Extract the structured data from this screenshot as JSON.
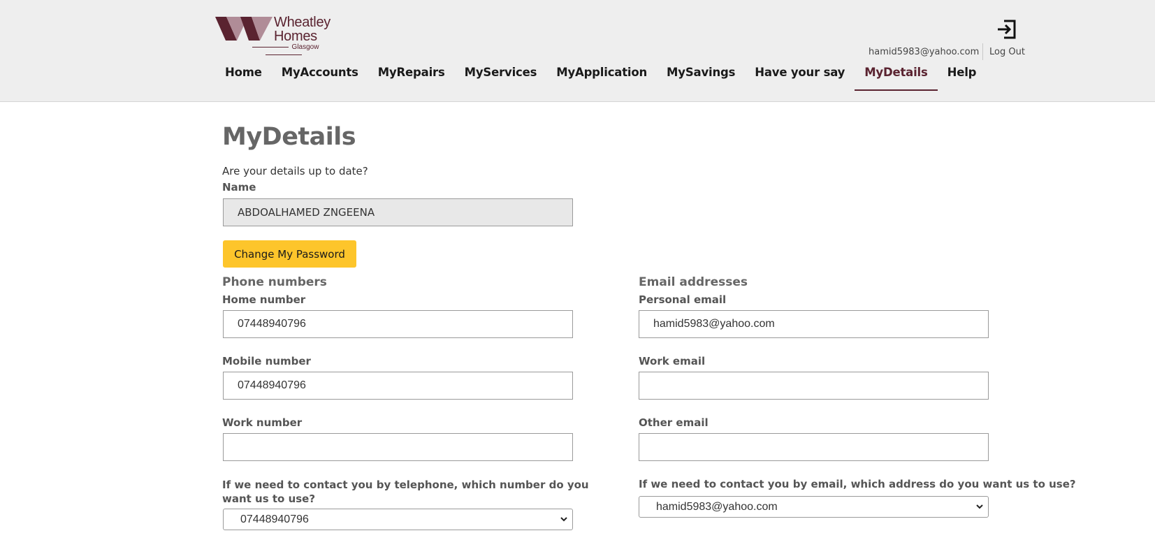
{
  "brand": {
    "line1": "Wheatley",
    "line2": "Homes",
    "sub": "Glasgow"
  },
  "header": {
    "user_email": "hamid5983@yahoo.com",
    "logout_label": "Log Out"
  },
  "nav": {
    "items": [
      {
        "label": "Home"
      },
      {
        "label": "MyAccounts"
      },
      {
        "label": "MyRepairs"
      },
      {
        "label": "MyServices"
      },
      {
        "label": "MyApplication"
      },
      {
        "label": "MySavings"
      },
      {
        "label": "Have your say"
      },
      {
        "label": "MyDetails",
        "active": true
      },
      {
        "label": "Help"
      }
    ]
  },
  "main": {
    "title": "MyDetails",
    "intro": "Are your details up to date?",
    "name_label": "Name",
    "name_value": "ABDOALHAMED ZNGEENA",
    "change_password_label": "Change My Password",
    "phone": {
      "section_title": "Phone numbers",
      "home_label": "Home number",
      "home_value": "07448940796",
      "mobile_label": "Mobile number",
      "mobile_value": "07448940796",
      "work_label": "Work number",
      "work_value": "",
      "preferred_label": "If we need to contact you by telephone, which number do you want us to use?",
      "preferred_value": "07448940796"
    },
    "email": {
      "section_title": "Email addresses",
      "personal_label": "Personal email",
      "personal_value": "hamid5983@yahoo.com",
      "work_label": "Work email",
      "work_value": "",
      "other_label": "Other email",
      "other_value": "",
      "preferred_label": "If we need to contact you by email, which address do you want us to use?",
      "preferred_value": "hamid5983@yahoo.com"
    }
  },
  "colors": {
    "brand": "#5a2330",
    "button": "#fdc52b",
    "header_bg": "#eeeeee"
  },
  "icons": {
    "logo": "wheatley-w-logo-icon",
    "logout": "logout-icon",
    "select_chevron": "chevron-down-icon"
  }
}
